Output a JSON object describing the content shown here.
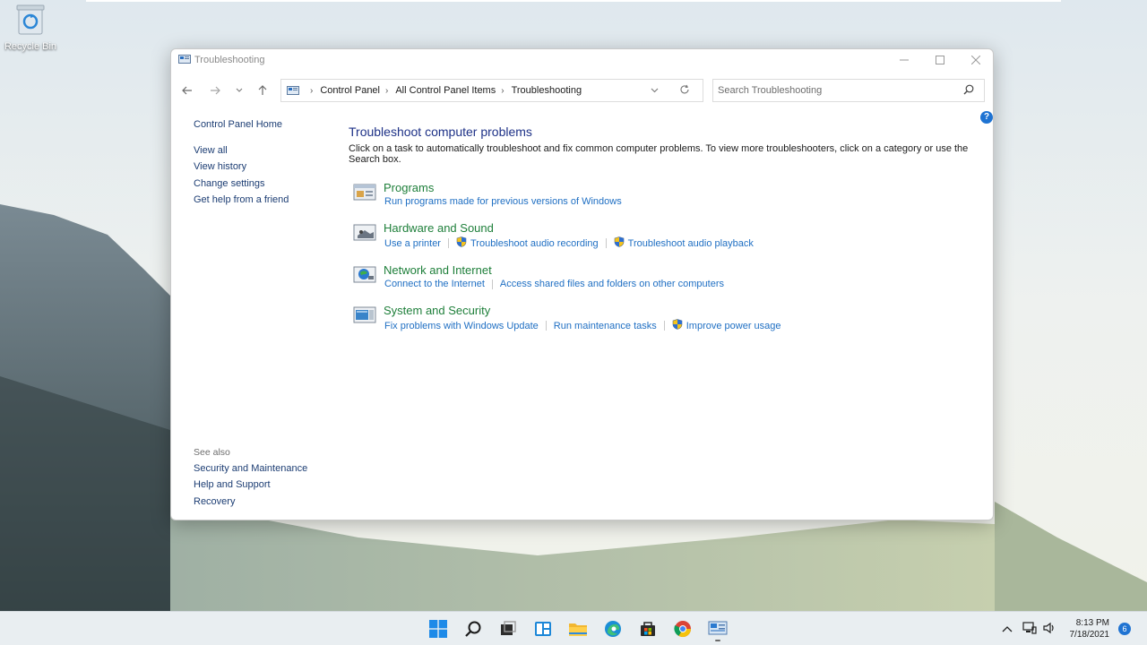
{
  "desktop": {
    "recycle_bin_label": "Recycle Bin"
  },
  "window": {
    "title": "Troubleshooting",
    "address": {
      "crumbs": [
        "Control Panel",
        "All Control Panel Items",
        "Troubleshooting"
      ]
    },
    "search": {
      "placeholder": "Search Troubleshooting",
      "value": ""
    },
    "left_pane": {
      "home": "Control Panel Home",
      "links": [
        "View all",
        "View history",
        "Change settings",
        "Get help from a friend"
      ],
      "see_also_label": "See also",
      "see_also": [
        "Security and Maintenance",
        "Help and Support",
        "Recovery"
      ]
    },
    "main": {
      "title": "Troubleshoot computer problems",
      "description": "Click on a task to automatically troubleshoot and fix common computer problems. To view more troubleshooters, click on a category or use the Search box.",
      "categories": [
        {
          "title": "Programs",
          "icon": "programs-icon",
          "links": [
            {
              "label": "Run programs made for previous versions of Windows",
              "shield": false
            }
          ]
        },
        {
          "title": "Hardware and Sound",
          "icon": "hardware-sound-icon",
          "links": [
            {
              "label": "Use a printer",
              "shield": false
            },
            {
              "label": "Troubleshoot audio recording",
              "shield": true
            },
            {
              "label": "Troubleshoot audio playback",
              "shield": true
            }
          ]
        },
        {
          "title": "Network and Internet",
          "icon": "network-internet-icon",
          "links": [
            {
              "label": "Connect to the Internet",
              "shield": false
            },
            {
              "label": "Access shared files and folders on other computers",
              "shield": false
            }
          ]
        },
        {
          "title": "System and Security",
          "icon": "system-security-icon",
          "links": [
            {
              "label": "Fix problems with Windows Update",
              "shield": false
            },
            {
              "label": "Run maintenance tasks",
              "shield": false
            },
            {
              "label": "Improve power usage",
              "shield": true
            }
          ]
        }
      ]
    }
  },
  "taskbar": {
    "apps": [
      "start-icon",
      "search-icon",
      "task-view-icon",
      "widgets-icon",
      "file-explorer-icon",
      "edge-icon",
      "store-icon",
      "chrome-icon",
      "control-panel-icon"
    ],
    "time": "8:13 PM",
    "date": "7/18/2021",
    "notification_count": "6"
  },
  "colors": {
    "accent": "#1f73d2",
    "link": "#1f6fc3",
    "category_title": "#1e7f3a",
    "heading": "#1e3287"
  }
}
